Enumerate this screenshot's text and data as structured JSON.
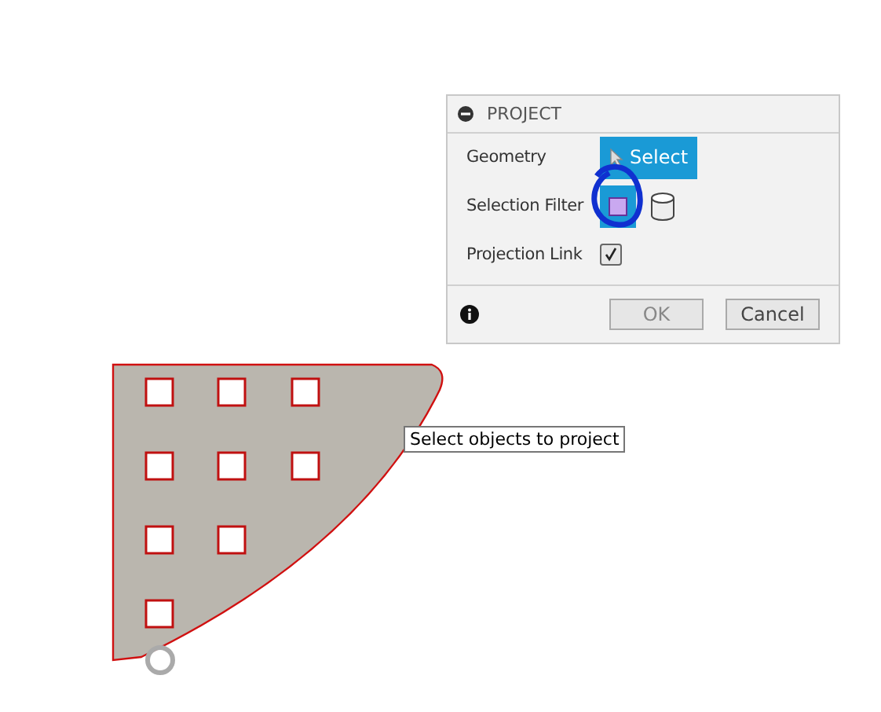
{
  "panel": {
    "title": "PROJECT",
    "rows": [
      {
        "kind": "select",
        "label": "Geometry",
        "button": "Select"
      },
      {
        "kind": "filter",
        "label": "Selection Filter",
        "selected": true
      },
      {
        "kind": "checkbox",
        "label": "Projection Link",
        "checked": true
      }
    ],
    "buttons": [
      {
        "label": "OK",
        "disabled": true
      },
      {
        "label": "Cancel",
        "disabled": false
      }
    ]
  },
  "tooltip": "Select objects to project"
}
